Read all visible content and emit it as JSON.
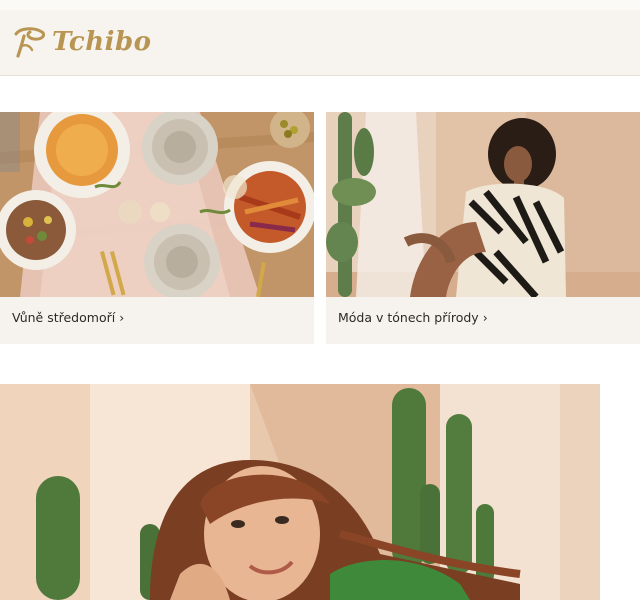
{
  "header": {
    "logo_text": "Tchibo"
  },
  "cards": [
    {
      "label": "Vůně středomoří",
      "chevron": "›"
    },
    {
      "label": "Móda v tónech přírody",
      "chevron": "›"
    }
  ],
  "colors": {
    "brand_gold": "#b89553",
    "header_bg": "#f7f4ef",
    "card_bg": "#f6f3ee",
    "text_dark": "#2d2a26"
  },
  "icons": {
    "logo_mark": "tchibo-logo-icon"
  }
}
